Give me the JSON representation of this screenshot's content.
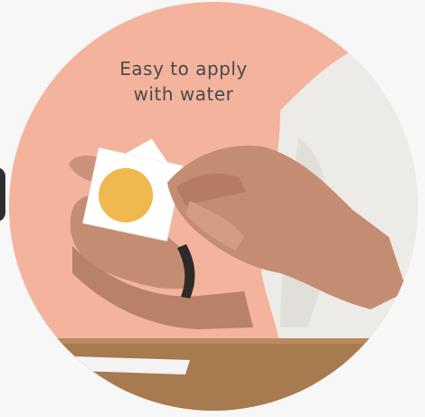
{
  "caption": {
    "line1": "Easy to apply",
    "line2": "with water"
  },
  "colors": {
    "page_background": "#f7f7f8",
    "circle_background": "#f3b39c",
    "shirt": "#ecebe7",
    "table": "#a77a4f",
    "skin": "#c48c71",
    "sticker_accent": "#f0b84e",
    "caption_text": "#4b4b4b"
  },
  "scene": {
    "subject": "hands-applying-temporary-tattoo",
    "sticker_text_line1": "",
    "sticker_text_line2": ""
  }
}
